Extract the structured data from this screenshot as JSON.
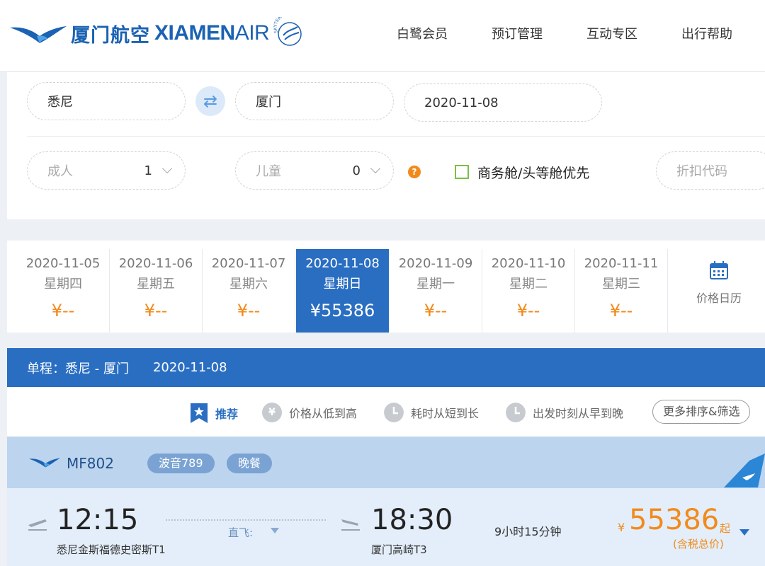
{
  "brand": {
    "name_cn": "厦门航空",
    "name_en_bold": "XIAMEN",
    "name_en_light": "AIR",
    "alliance": "SKYTEAM",
    "color": "#1b62b3"
  },
  "nav": [
    {
      "label": "白鹭会员"
    },
    {
      "label": "预订管理"
    },
    {
      "label": "互动专区"
    },
    {
      "label": "出行帮助"
    }
  ],
  "search": {
    "origin": "悉尼",
    "destination": "厦门",
    "date": "2020-11-08",
    "adult_label": "成人",
    "adult_count": "1",
    "child_label": "儿童",
    "child_count": "0",
    "help_icon_text": "?",
    "business_first_label": "商务舱/头等舱优先",
    "discount_code_placeholder": "折扣代码"
  },
  "date_strip": {
    "days": [
      {
        "date": "2020-11-05",
        "weekday": "星期四",
        "price": "¥--"
      },
      {
        "date": "2020-11-06",
        "weekday": "星期五",
        "price": "¥--"
      },
      {
        "date": "2020-11-07",
        "weekday": "星期六",
        "price": "¥--"
      },
      {
        "date": "2020-11-08",
        "weekday": "星期日",
        "price": "¥55386",
        "active": true
      },
      {
        "date": "2020-11-09",
        "weekday": "星期一",
        "price": "¥--"
      },
      {
        "date": "2020-11-10",
        "weekday": "星期二",
        "price": "¥--"
      },
      {
        "date": "2020-11-11",
        "weekday": "星期三",
        "price": "¥--"
      }
    ],
    "calendar_label": "价格日历"
  },
  "route": {
    "label": "单程：悉尼 - 厦门",
    "date": "2020-11-08"
  },
  "sort": {
    "recommend": "推荐",
    "price_icon_text": "¥",
    "price": "价格从低到高",
    "duration": "耗时从短到长",
    "departure": "出发时刻从早到晚",
    "more": "更多排序&筛选"
  },
  "flight": {
    "number": "MF802",
    "aircraft": "波音789",
    "meal": "晚餐",
    "dep_time": "12:15",
    "dep_airport": "悉尼金斯福德史密斯T1",
    "stop_type": "直飞:",
    "arr_time": "18:30",
    "arr_airport": "厦门高崎T3",
    "duration": "9小时15分钟",
    "currency": "¥",
    "price": "55386",
    "price_suffix": "起",
    "tax_note": "(含税总价)"
  },
  "colors": {
    "accent_blue": "#2a6ec2",
    "price_orange": "#f28a1b",
    "checkbox_green": "#7cbf47"
  }
}
